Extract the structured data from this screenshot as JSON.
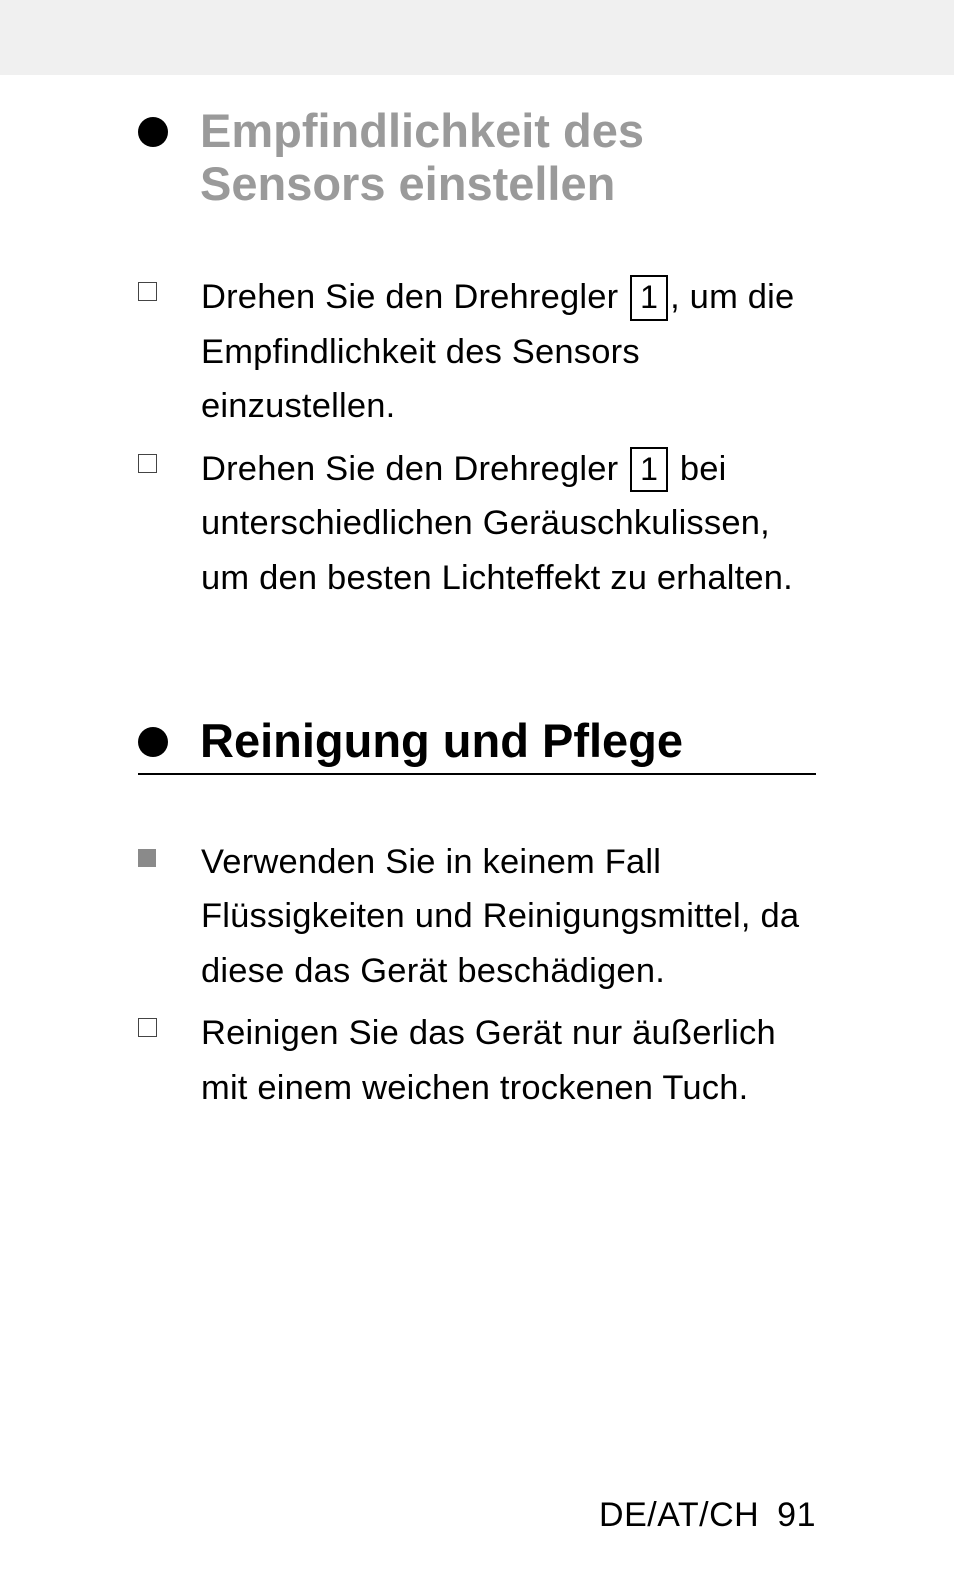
{
  "section1": {
    "title": "Empfindlichkeit des Sensors einstellen",
    "items": [
      {
        "text_before_ref": "Drehen Sie den Drehregler ",
        "ref": "1",
        "text_after_ref": ", um die Empfindlichkeit des Sensors einzustellen."
      },
      {
        "text_before_ref": "Drehen Sie den Drehregler ",
        "ref": "1",
        "text_after_ref": " bei unterschiedlichen Geräusch­kulissen, um den besten Lichteffekt zu erhalten."
      }
    ]
  },
  "section2": {
    "title": "Reinigung und Pflege",
    "items": [
      {
        "bullet": "filled",
        "text": "Verwenden Sie in keinem Fall Flüssigkeiten und Reinigungsmittel, da diese das Gerät beschädigen."
      },
      {
        "bullet": "checkbox",
        "text": "Reinigen Sie das Gerät nur äußer­lich mit einem weichen trockenen Tuch."
      }
    ]
  },
  "footer": {
    "locale": "DE/AT/CH",
    "page": "91"
  }
}
